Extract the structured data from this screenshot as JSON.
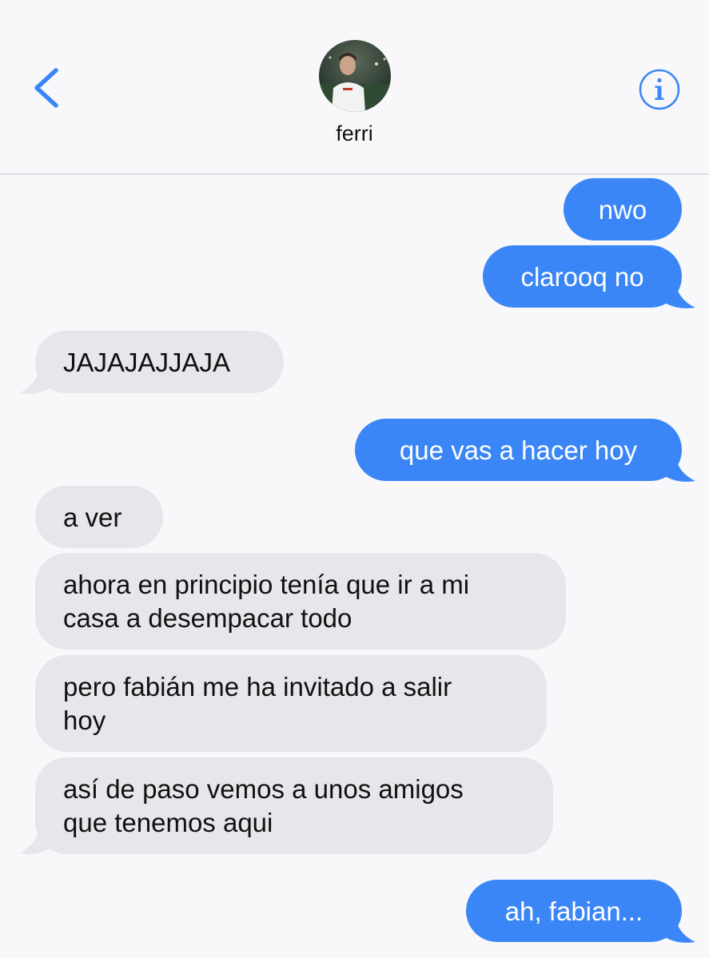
{
  "header": {
    "contact_name": "ferri",
    "back_icon": "chevron-left-icon",
    "info_icon": "info-icon",
    "accent_color": "#3b86f7"
  },
  "messages": [
    {
      "from": "me",
      "text": "nwo"
    },
    {
      "from": "me",
      "text": "clarooq no"
    },
    {
      "from": "them",
      "text": "JAJAJAJJAJA"
    },
    {
      "from": "me",
      "text": "que vas a hacer hoy"
    },
    {
      "from": "them",
      "text": "a ver"
    },
    {
      "from": "them",
      "lines": [
        "ahora en principio tenía que ir a mi",
        "casa a desempacar todo"
      ]
    },
    {
      "from": "them",
      "lines": [
        "pero fabián me ha invitado a salir",
        "hoy"
      ]
    },
    {
      "from": "them",
      "lines": [
        "así de paso vemos a unos amigos",
        "que tenemos aqui"
      ]
    },
    {
      "from": "me",
      "text": "ah, fabian..."
    }
  ],
  "colors": {
    "sent_bubble": "#3b86f7",
    "received_bubble": "#e6e6eb",
    "background": "#f8f8fa"
  }
}
